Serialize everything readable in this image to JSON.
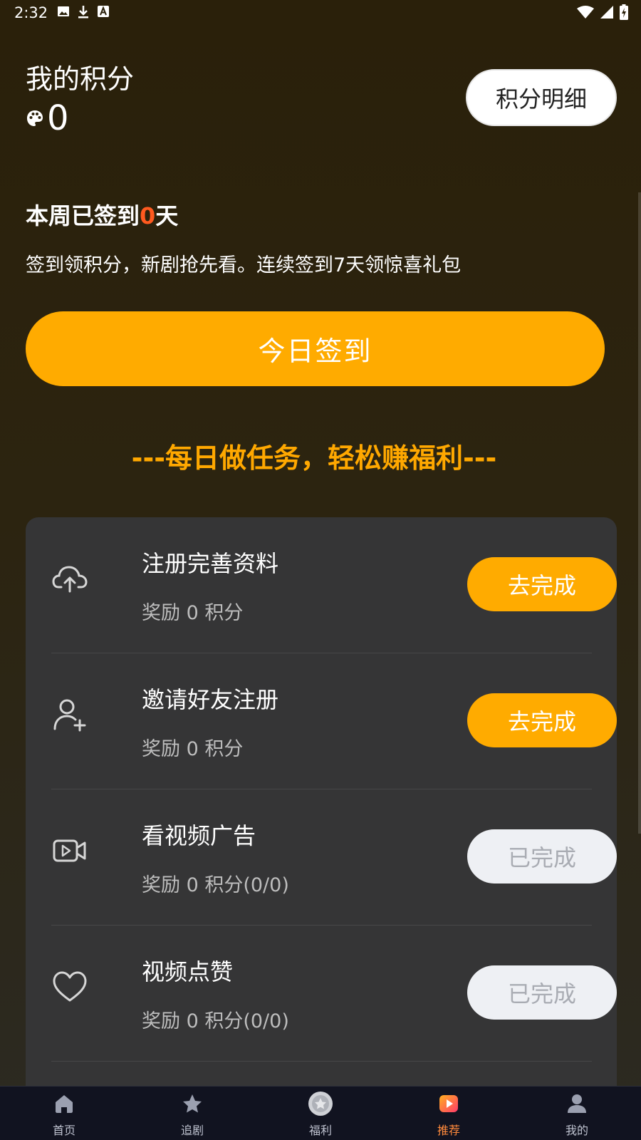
{
  "status": {
    "time": "2:32"
  },
  "header": {
    "title": "我的积分",
    "points": "0",
    "detail_button": "积分明细"
  },
  "checkin": {
    "weekly_prefix": "本周已签到",
    "weekly_days": "0",
    "weekly_suffix": "天",
    "description": "签到领积分，新剧抢先看。连续签到7天领惊喜礼包",
    "button": "今日签到"
  },
  "tasks_heading": "---每日做任务，轻松赚福利---",
  "tasks": [
    {
      "name": "注册完善资料",
      "reward": "奖励 0 积分",
      "button": "去完成",
      "state": "todo",
      "icon": "cloud-upload-icon"
    },
    {
      "name": "邀请好友注册",
      "reward": "奖励 0 积分",
      "button": "去完成",
      "state": "todo",
      "icon": "add-user-icon"
    },
    {
      "name": "看视频广告",
      "reward": "奖励 0 积分(0/0)",
      "button": "已完成",
      "state": "done",
      "icon": "video-icon"
    },
    {
      "name": "视频点赞",
      "reward": "奖励 0 积分(0/0)",
      "button": "已完成",
      "state": "done",
      "icon": "heart-icon"
    }
  ],
  "nav": [
    {
      "label": "首页",
      "icon": "home-icon"
    },
    {
      "label": "追剧",
      "icon": "star-icon"
    },
    {
      "label": "福利",
      "icon": "welfare-icon"
    },
    {
      "label": "推荐",
      "icon": "recommend-icon",
      "active": true
    },
    {
      "label": "我的",
      "icon": "profile-icon"
    }
  ],
  "colors": {
    "accent": "#ffab00",
    "highlight": "#ff5a1f",
    "nav_active": "#ff8a3c"
  }
}
